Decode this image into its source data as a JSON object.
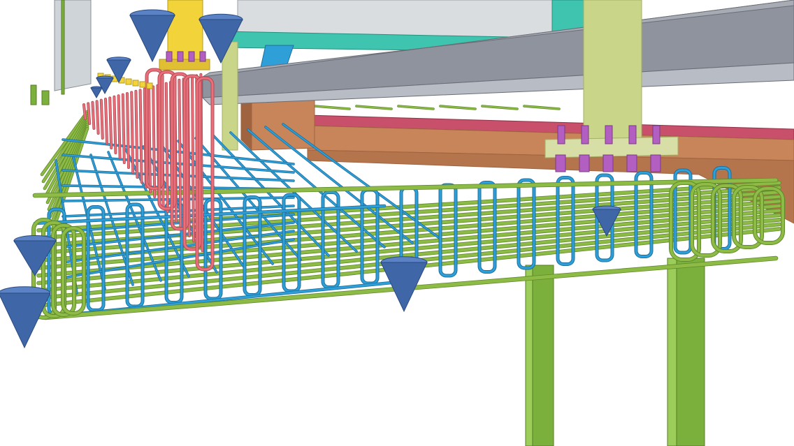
{
  "scene": {
    "colors": {
      "background": "#ffffff",
      "rebar_longitudinal": "#8dbb45",
      "rebar_longitudinal_dark": "#5f8a2a",
      "rebar_stirrup": "#2f9fd8",
      "rebar_stirrup_dark": "#1c6f9e",
      "rebar_vertical": "#e8707a",
      "rebar_vertical_dark": "#b44a55",
      "steel_beam": "#8f939e",
      "steel_beam_dark": "#6a6d76",
      "column": "#c9d68a",
      "column_dark": "#a4b064",
      "support_pipe": "#7bb03c",
      "support_pipe_dark": "#557c25",
      "wood_block": "#c8855a",
      "wood_block_dark": "#a06340",
      "brace_teal": "#3fc4b0",
      "bracket_yellow": "#f2d43a",
      "spacer_cone": "#3f67a8",
      "spacer_cone_dark": "#2a4a80",
      "bolt": "#b35fc2",
      "panel": "#cfd4d8",
      "red_rail": "#c9506a"
    }
  }
}
